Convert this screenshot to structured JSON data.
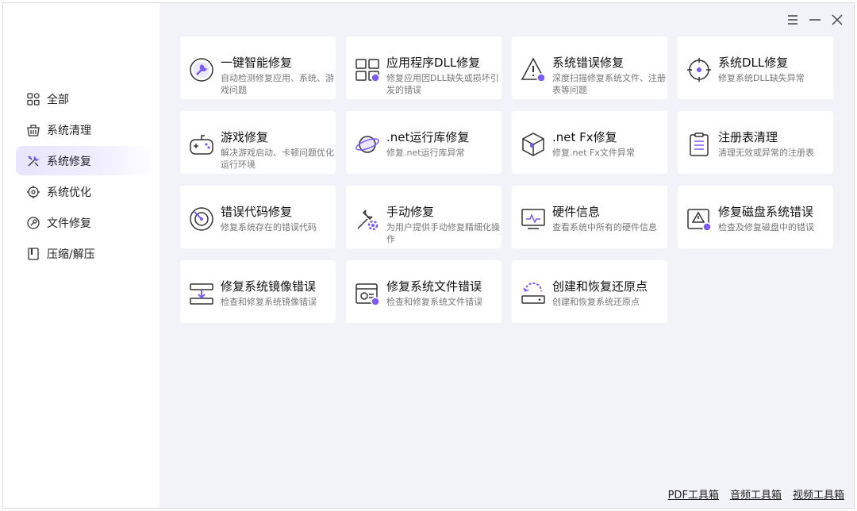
{
  "window_controls": {
    "menu_icon": "menu-icon",
    "minimize_icon": "minimize-icon",
    "close_icon": "close-icon"
  },
  "sidebar": {
    "items": [
      {
        "label": "全部",
        "icon": "grid-icon",
        "active": false
      },
      {
        "label": "系统清理",
        "icon": "broom-icon",
        "active": false
      },
      {
        "label": "系统修复",
        "icon": "tools-icon",
        "active": true
      },
      {
        "label": "系统优化",
        "icon": "target-icon",
        "active": false
      },
      {
        "label": "文件修复",
        "icon": "file-wrench-icon",
        "active": false
      },
      {
        "label": "压缩/解压",
        "icon": "archive-icon",
        "active": false
      }
    ]
  },
  "cards": [
    {
      "title": "一键智能修复",
      "desc": "自动检测修复应用、系统、游戏问题",
      "icon": "wrench-circle-icon"
    },
    {
      "title": "应用程序DLL修复",
      "desc": "修复应用因DLL缺失或损坏引发的错误",
      "icon": "app-grid-icon"
    },
    {
      "title": "系统错误修复",
      "desc": "深度扫描修复系统文件、注册表等问题",
      "icon": "warning-triangle-icon"
    },
    {
      "title": "系统DLL修复",
      "desc": "修复系统DLL缺失异常",
      "icon": "crosshair-icon"
    },
    {
      "title": "游戏修复",
      "desc": "解决游戏启动、卡顿问题优化运行环境",
      "icon": "gamepad-icon"
    },
    {
      "title": ".net运行库修复",
      "desc": "修复.net运行库异常",
      "icon": "planet-icon"
    },
    {
      "title": ".net Fx修复",
      "desc": "修复.net Fx文件异常",
      "icon": "cube-icon"
    },
    {
      "title": "注册表清理",
      "desc": "清理无效或异常的注册表",
      "icon": "clipboard-icon"
    },
    {
      "title": "错误代码修复",
      "desc": "修复系统存在的错误代码",
      "icon": "radar-icon"
    },
    {
      "title": "手动修复",
      "desc": "为用户提供手动修复精细化操作",
      "icon": "wrench-gear-icon"
    },
    {
      "title": "硬件信息",
      "desc": "查看系统中所有的硬件信息",
      "icon": "monitor-pulse-icon"
    },
    {
      "title": "修复磁盘系统错误",
      "desc": "检查及修复磁盘中的错误",
      "icon": "disk-warning-icon"
    },
    {
      "title": "修复系统镜像错误",
      "desc": "检查和修复系统镜像错误",
      "icon": "image-download-icon"
    },
    {
      "title": "修复系统文件错误",
      "desc": "检查和修复系统文件错误",
      "icon": "window-gear-icon"
    },
    {
      "title": "创建和恢复还原点",
      "desc": "创建和恢复系统还原点",
      "icon": "restore-point-icon"
    }
  ],
  "footer": {
    "pdf_tool": "PDF工具箱",
    "audio_tool": "音频工具箱",
    "video_tool": "视频工具箱"
  },
  "colors": {
    "accent": "#7b5cf5",
    "active_bg": "#ece8ff",
    "content_bg": "#f2f2f9",
    "icon_stroke": "#333333"
  }
}
